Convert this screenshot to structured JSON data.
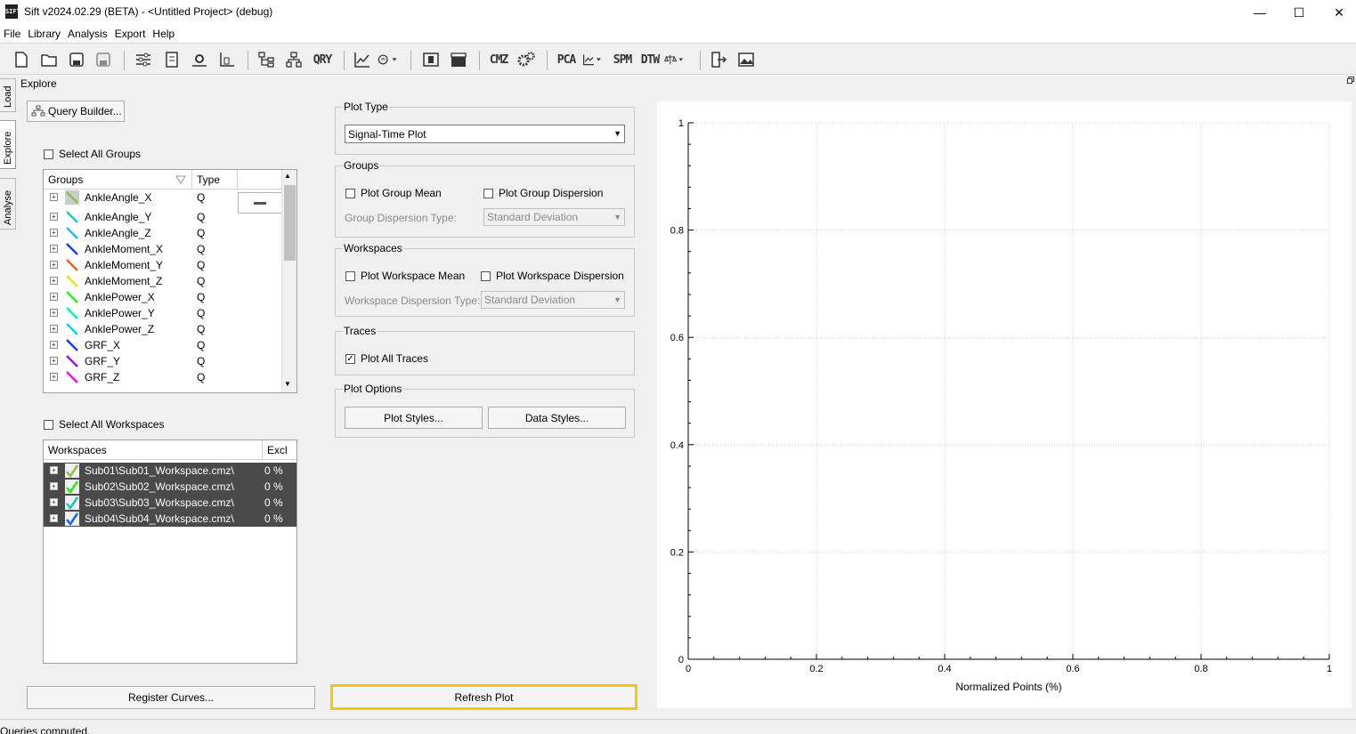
{
  "window": {
    "app_icon": "SIFT",
    "title": "Sift v2024.02.29 (BETA) - <Untitled Project> (debug)",
    "controls": {
      "minimize": "—",
      "maximize": "☐",
      "close": "✕"
    }
  },
  "menu": [
    "File",
    "Library",
    "Analysis",
    "Export",
    "Help"
  ],
  "toolbar": {
    "text_buttons": {
      "qry": "QRY",
      "cmz": "CMZ",
      "pca": "PCA",
      "spm": "SPM",
      "dtw": "DTW"
    }
  },
  "side_tabs": [
    "Load",
    "Explore",
    "Analyse"
  ],
  "panel_title": "Explore",
  "query_builder_label": "Query Builder...",
  "select_all_groups_label": "Select All Groups",
  "groups_table": {
    "headers": [
      "Groups",
      "Type"
    ],
    "rows": [
      {
        "name": "AnkleAngle_X",
        "type": "Q",
        "color": "#8cc152"
      },
      {
        "name": "AnkleAngle_Y",
        "type": "Q",
        "color": "#1fc7b3"
      },
      {
        "name": "AnkleAngle_Z",
        "type": "Q",
        "color": "#28b6e8"
      },
      {
        "name": "AnkleMoment_X",
        "type": "Q",
        "color": "#1640d6"
      },
      {
        "name": "AnkleMoment_Y",
        "type": "Q",
        "color": "#e8631a"
      },
      {
        "name": "AnkleMoment_Z",
        "type": "Q",
        "color": "#e8e21a"
      },
      {
        "name": "AnklePower_X",
        "type": "Q",
        "color": "#2ee81a"
      },
      {
        "name": "AnklePower_Y",
        "type": "Q",
        "color": "#1ae8a0"
      },
      {
        "name": "AnklePower_Z",
        "type": "Q",
        "color": "#1ac9e8"
      },
      {
        "name": "GRF_X",
        "type": "Q",
        "color": "#1a3ae8"
      },
      {
        "name": "GRF_Y",
        "type": "Q",
        "color": "#8a1ae8"
      },
      {
        "name": "GRF_Z",
        "type": "Q",
        "color": "#e81ac4"
      }
    ]
  },
  "select_all_workspaces_label": "Select All Workspaces",
  "workspaces_table": {
    "headers": [
      "Workspaces",
      "Excl"
    ],
    "rows": [
      {
        "name": "Sub01\\Sub01_Workspace.cmz\\",
        "excl": "0 %",
        "color": "#8cc152"
      },
      {
        "name": "Sub02\\Sub02_Workspace.cmz\\",
        "excl": "0 %",
        "color": "#2ee81a"
      },
      {
        "name": "Sub03\\Sub03_Workspace.cmz\\",
        "excl": "0 %",
        "color": "#1fc7b3"
      },
      {
        "name": "Sub04\\Sub04_Workspace.cmz\\",
        "excl": "0 %",
        "color": "#1a6ae8"
      }
    ]
  },
  "plot_type": {
    "title": "Plot Type",
    "value": "Signal-Time Plot"
  },
  "groups_box": {
    "title": "Groups",
    "plot_mean": "Plot Group Mean",
    "plot_dispersion": "Plot Group Dispersion",
    "dispersion_type_label": "Group Dispersion Type:",
    "dispersion_type_value": "Standard Deviation"
  },
  "workspaces_box": {
    "title": "Workspaces",
    "plot_mean": "Plot Workspace Mean",
    "plot_dispersion": "Plot Workspace Dispersion",
    "dispersion_type_label": "Workspace Dispersion Type:",
    "dispersion_type_value": "Standard Deviation"
  },
  "traces_box": {
    "title": "Traces",
    "plot_all": "Plot All Traces",
    "plot_all_checked": true
  },
  "plot_options": {
    "title": "Plot Options",
    "plot_styles": "Plot Styles...",
    "data_styles": "Data Styles..."
  },
  "register_curves_label": "Register Curves...",
  "refresh_plot_label": "Refresh Plot",
  "chart_data": {
    "type": "line",
    "series": [],
    "xlabel": "Normalized Points (%)",
    "ylabel": "",
    "xlim": [
      0,
      1
    ],
    "ylim": [
      0,
      1
    ],
    "x_ticks": [
      "0",
      "0.2",
      "0.4",
      "0.6",
      "0.8",
      "1"
    ],
    "y_ticks": [
      "0",
      "0.2",
      "0.4",
      "0.6",
      "0.8",
      "1"
    ],
    "grid": true
  },
  "status": "Queries computed."
}
